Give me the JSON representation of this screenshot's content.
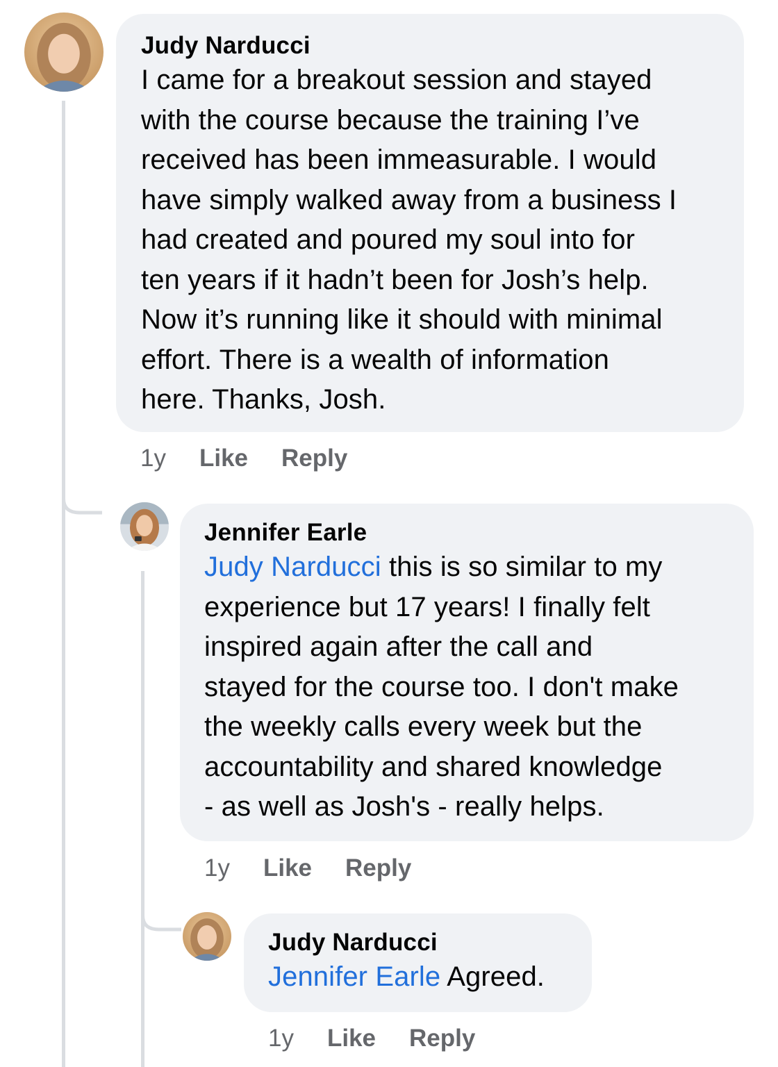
{
  "comments": [
    {
      "author": "Judy Narducci",
      "lines": [
        "I came for a breakout session and stayed",
        "with the course because the training I’ve",
        "received has been immeasurable. I would",
        "have simply walked away from a business I",
        "had created and poured my soul into for",
        "ten years if it hadn’t been for Josh’s help.",
        "Now it’s running like it should with minimal",
        "effort. There is a wealth of information",
        "here. Thanks, Josh."
      ],
      "time": "1y",
      "like": "Like",
      "reply": "Reply"
    },
    {
      "author": "Jennifer Earle",
      "mention": "Judy Narducci",
      "first_line_rest": " this is so similar to my",
      "lines": [
        "experience but 17 years! I finally felt",
        "inspired again after the call and",
        "stayed for the course too. I don't make",
        "the weekly calls every week but the",
        "accountability and shared knowledge",
        "- as well as Josh's - really helps."
      ],
      "time": "1y",
      "like": "Like",
      "reply": "Reply"
    },
    {
      "author": "Judy Narducci",
      "mention": "Jennifer Earle",
      "text": " Agreed.",
      "time": "1y",
      "like": "Like",
      "reply": "Reply"
    }
  ],
  "colors": {
    "bubble": "#f0f2f5",
    "mention": "#216fdb",
    "meta": "#65676b",
    "thread_line": "#dadde1"
  }
}
